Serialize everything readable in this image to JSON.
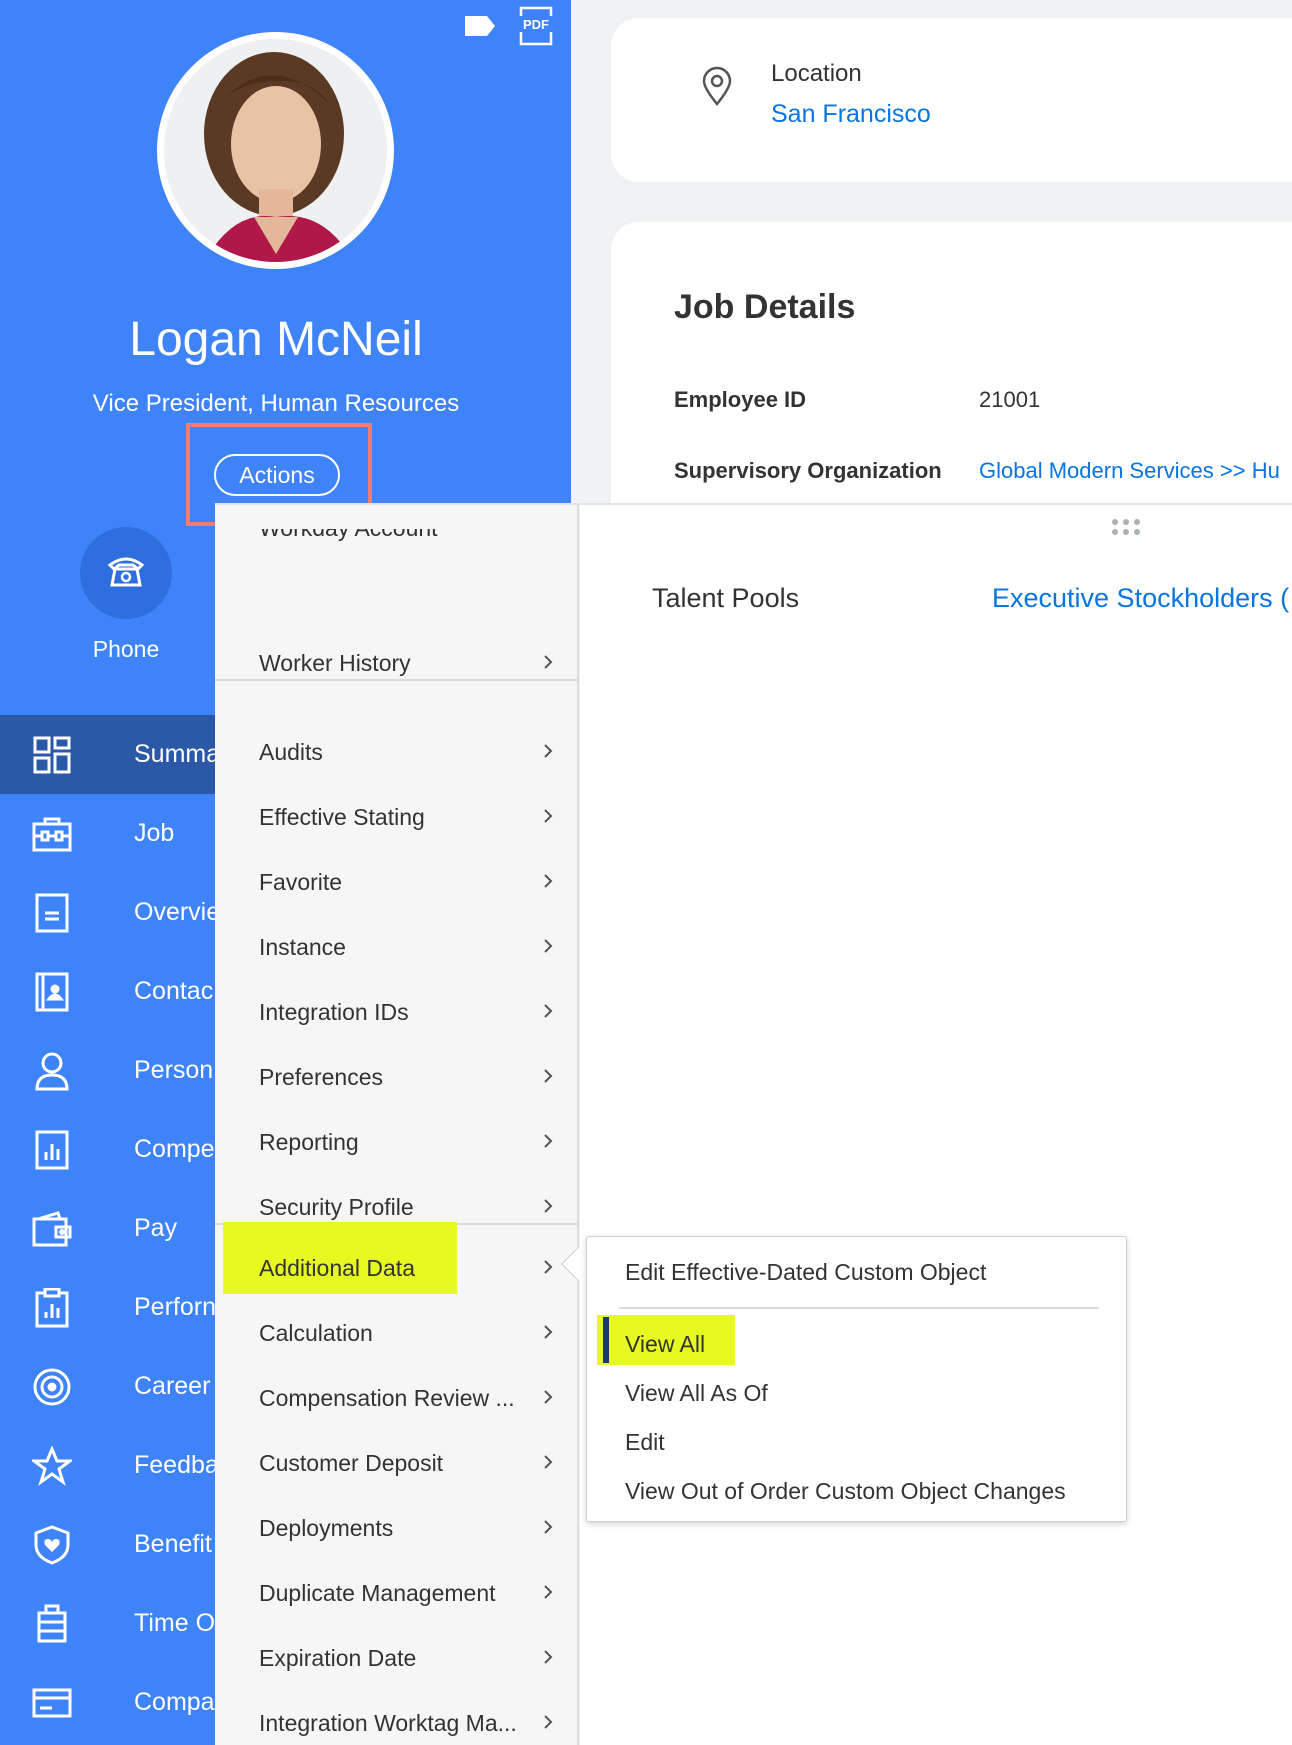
{
  "profile": {
    "name": "Logan McNeil",
    "title": "Vice President, Human Resources",
    "actions_label": "Actions",
    "phone_label": "Phone",
    "pdf_label": "PDF"
  },
  "sidebar": {
    "items": [
      {
        "label": "Summa",
        "icon": "summary-grid-icon",
        "active": true
      },
      {
        "label": "Job",
        "icon": "briefcase-icon"
      },
      {
        "label": "Overvie",
        "icon": "document-icon"
      },
      {
        "label": "Contac",
        "icon": "contact-card-icon"
      },
      {
        "label": "Person",
        "icon": "person-icon"
      },
      {
        "label": "Compe",
        "icon": "compensation-chart-icon"
      },
      {
        "label": "Pay",
        "icon": "wallet-icon"
      },
      {
        "label": "Perforn",
        "icon": "performance-clipboard-icon"
      },
      {
        "label": "Career",
        "icon": "target-icon"
      },
      {
        "label": "Feedba",
        "icon": "star-icon"
      },
      {
        "label": "Benefit",
        "icon": "shield-heart-icon"
      },
      {
        "label": "Time O",
        "icon": "luggage-icon"
      },
      {
        "label": "Compa",
        "icon": "card-icon"
      }
    ]
  },
  "location": {
    "label": "Location",
    "value": "San Francisco"
  },
  "job_details": {
    "title": "Job Details",
    "employee_id_label": "Employee ID",
    "employee_id_value": "21001",
    "sup_org_label": "Supervisory Organization",
    "sup_org_value": "Global Modern Services >> Hu"
  },
  "talent": {
    "label": "Talent Pools",
    "value": "Executive Stockholders ("
  },
  "actions_menu": {
    "partial_top": "Workday Account",
    "worker_history": "Worker History",
    "group2": [
      "Audits",
      "Effective Stating",
      "Favorite",
      "Instance",
      "Integration IDs",
      "Preferences",
      "Reporting",
      "Security Profile"
    ],
    "group3": [
      "Additional Data",
      "Calculation",
      "Compensation Review ...",
      "Customer Deposit",
      "Deployments",
      "Duplicate Management",
      "Expiration Date",
      "Integration Worktag Ma..."
    ]
  },
  "submenu": {
    "edit_custom": "Edit Effective-Dated Custom Object",
    "view_all": "View All",
    "view_all_as_of": "View All As Of",
    "edit": "Edit",
    "view_out_of_order": "View Out of Order Custom Object Changes"
  },
  "colors": {
    "sidebar_blue": "#3f83f8",
    "active_nav": "#2b59a8",
    "link": "#0875e1",
    "highlight": "#e6fa21",
    "annotation": "#f47d73"
  }
}
